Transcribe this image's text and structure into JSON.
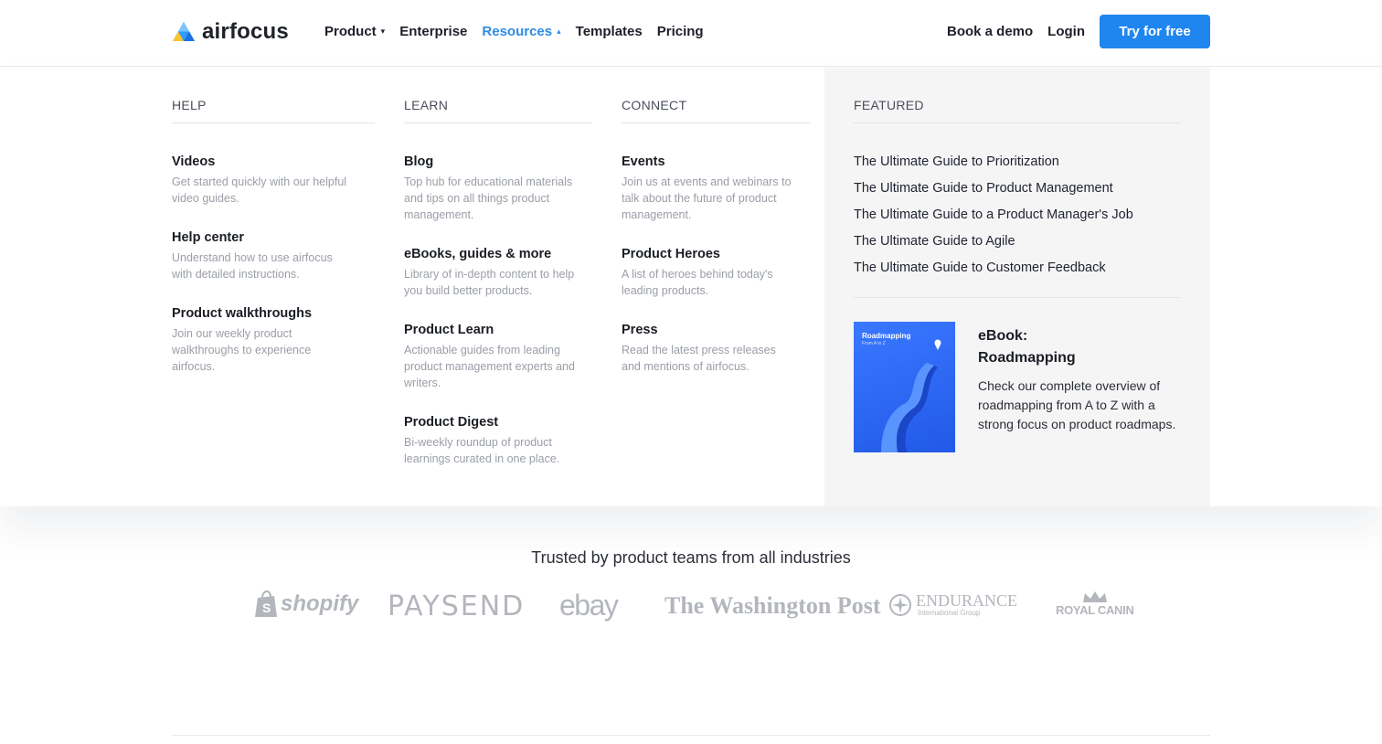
{
  "brand": {
    "name": "airfocus"
  },
  "nav": {
    "items": [
      {
        "label": "Product",
        "has_caret": true,
        "caret": "▾"
      },
      {
        "label": "Enterprise"
      },
      {
        "label": "Resources",
        "has_caret": true,
        "caret": "▴",
        "active": true
      },
      {
        "label": "Templates"
      },
      {
        "label": "Pricing"
      }
    ],
    "book_demo": "Book a demo",
    "login": "Login",
    "cta": "Try for free"
  },
  "menu": {
    "help": {
      "title": "HELP",
      "items": [
        {
          "title": "Videos",
          "desc": "Get started quickly with our helpful video guides."
        },
        {
          "title": "Help center",
          "desc": "Understand how to use airfocus with detailed instructions."
        },
        {
          "title": "Product walkthroughs",
          "desc": "Join our weekly product walkthroughs to experience airfocus."
        }
      ]
    },
    "learn": {
      "title": "LEARN",
      "items": [
        {
          "title": "Blog",
          "desc": "Top hub for educational materials and tips on all things product management."
        },
        {
          "title": "eBooks, guides & more",
          "desc": "Library of in-depth content to help you build better products."
        },
        {
          "title": "Product Learn",
          "desc": "Actionable guides from leading product management experts and writers."
        },
        {
          "title": "Product Digest",
          "desc": "Bi-weekly roundup of product learnings curated in one place."
        }
      ]
    },
    "connect": {
      "title": "CONNECT",
      "items": [
        {
          "title": "Events",
          "desc": "Join us at events and webinars to talk about the future of product management."
        },
        {
          "title": "Product Heroes",
          "desc": "A list of heroes behind today's leading products."
        },
        {
          "title": "Press",
          "desc": "Read the latest press releases and mentions of airfocus."
        }
      ]
    },
    "featured": {
      "title": "FEATURED",
      "links": [
        "The Ultimate Guide to Prioritization",
        "The Ultimate Guide to Product Management",
        "The Ultimate Guide to a Product Manager's Job",
        "The Ultimate Guide to Agile",
        "The Ultimate Guide to Customer Feedback"
      ],
      "ebook": {
        "cover_title": "Roadmapping",
        "cover_subtitle": "From A to Z",
        "title_line1": "eBook:",
        "title_line2": "Roadmapping",
        "desc": "Check our complete overview of roadmapping from A to Z with a strong focus on product roadmaps."
      }
    }
  },
  "trusted": {
    "heading": "Trusted by product teams from all industries",
    "logos": [
      "shopify",
      "PAYSEND",
      "ebay",
      "The Washington Post",
      "ENDURANCE",
      "International Group",
      "ROYAL CANIN"
    ]
  },
  "colors": {
    "accent": "#1f86f0",
    "active_nav": "#2e8be6",
    "featured_bg": "#f5f5f6",
    "logo_gray": "#b3b6bc"
  }
}
